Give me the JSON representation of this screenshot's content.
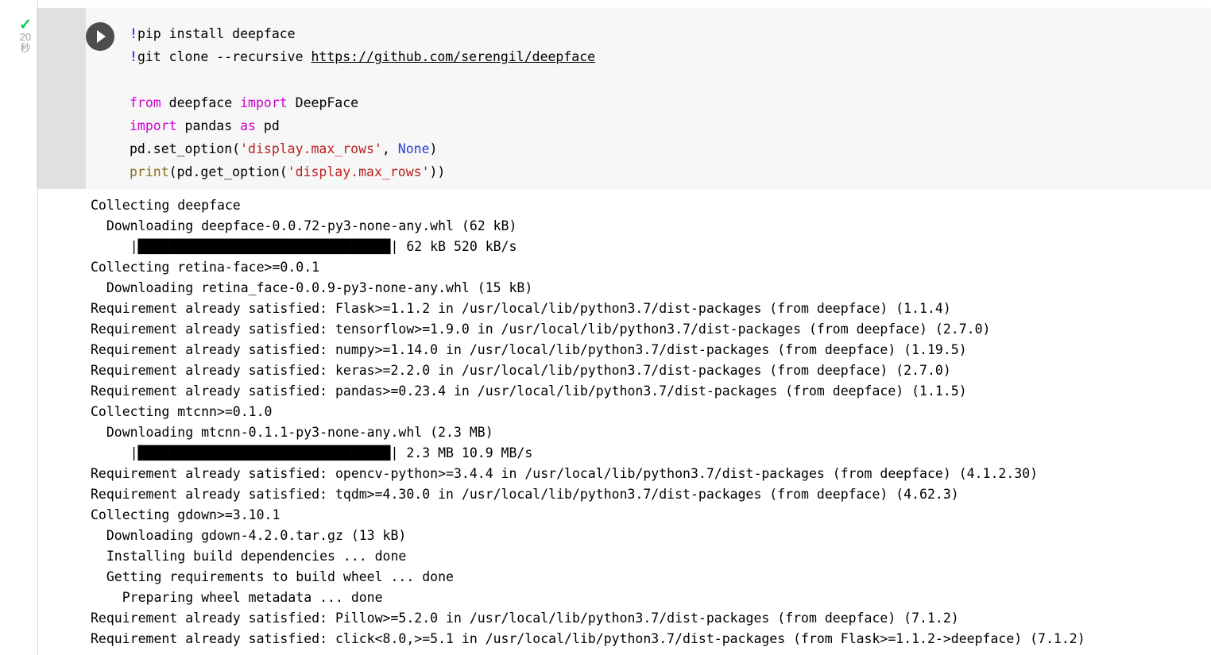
{
  "cell": {
    "execution_status_icon": "check-icon",
    "elapsed_value": "20",
    "elapsed_unit": "秒",
    "run_icon": "play-icon",
    "code_lines": [
      [
        {
          "t": "!",
          "c": "bang"
        },
        {
          "t": "pip install deepface",
          "c": "plain"
        }
      ],
      [
        {
          "t": "!",
          "c": "bang"
        },
        {
          "t": "git clone --recursive ",
          "c": "plain"
        },
        {
          "t": "https://github.com/serengil/deepface",
          "c": "link"
        }
      ],
      [
        {
          "t": "",
          "c": "plain"
        }
      ],
      [
        {
          "t": "from",
          "c": "kw"
        },
        {
          "t": " deepface ",
          "c": "plain"
        },
        {
          "t": "import",
          "c": "kw"
        },
        {
          "t": " DeepFace",
          "c": "plain"
        }
      ],
      [
        {
          "t": "import",
          "c": "kw"
        },
        {
          "t": " pandas ",
          "c": "plain"
        },
        {
          "t": "as",
          "c": "kw"
        },
        {
          "t": " pd",
          "c": "plain"
        }
      ],
      [
        {
          "t": "pd.set_option(",
          "c": "plain"
        },
        {
          "t": "'display.max_rows'",
          "c": "str"
        },
        {
          "t": ", ",
          "c": "plain"
        },
        {
          "t": "None",
          "c": "const"
        },
        {
          "t": ")",
          "c": "plain"
        }
      ],
      [
        {
          "t": "print",
          "c": "builtin"
        },
        {
          "t": "(pd.get_option(",
          "c": "plain"
        },
        {
          "t": "'display.max_rows'",
          "c": "str"
        },
        {
          "t": "))",
          "c": "plain"
        }
      ]
    ]
  },
  "output": {
    "lines": [
      "Collecting deepface",
      "  Downloading deepface-0.0.72-py3-none-any.whl (62 kB)",
      "     |████████████████████████████████| 62 kB 520 kB/s",
      "Collecting retina-face>=0.0.1",
      "  Downloading retina_face-0.0.9-py3-none-any.whl (15 kB)",
      "Requirement already satisfied: Flask>=1.1.2 in /usr/local/lib/python3.7/dist-packages (from deepface) (1.1.4)",
      "Requirement already satisfied: tensorflow>=1.9.0 in /usr/local/lib/python3.7/dist-packages (from deepface) (2.7.0)",
      "Requirement already satisfied: numpy>=1.14.0 in /usr/local/lib/python3.7/dist-packages (from deepface) (1.19.5)",
      "Requirement already satisfied: keras>=2.2.0 in /usr/local/lib/python3.7/dist-packages (from deepface) (2.7.0)",
      "Requirement already satisfied: pandas>=0.23.4 in /usr/local/lib/python3.7/dist-packages (from deepface) (1.1.5)",
      "Collecting mtcnn>=0.1.0",
      "  Downloading mtcnn-0.1.1-py3-none-any.whl (2.3 MB)",
      "     |████████████████████████████████| 2.3 MB 10.9 MB/s",
      "Requirement already satisfied: opencv-python>=3.4.4 in /usr/local/lib/python3.7/dist-packages (from deepface) (4.1.2.30)",
      "Requirement already satisfied: tqdm>=4.30.0 in /usr/local/lib/python3.7/dist-packages (from deepface) (4.62.3)",
      "Collecting gdown>=3.10.1",
      "  Downloading gdown-4.2.0.tar.gz (13 kB)",
      "  Installing build dependencies ... done",
      "  Getting requirements to build wheel ... done",
      "    Preparing wheel metadata ... done",
      "Requirement already satisfied: Pillow>=5.2.0 in /usr/local/lib/python3.7/dist-packages (from deepface) (7.1.2)",
      "Requirement already satisfied: click<8.0,>=5.1 in /usr/local/lib/python3.7/dist-packages (from Flask>=1.1.2->deepface) (7.1.2)"
    ]
  },
  "colors": {
    "cell_background": "#f7f7f7",
    "gutter_background": "#e0e0e0",
    "run_button": "#4d4d4d",
    "success_check": "#00c853",
    "keyword": "#cc00cc",
    "string": "#ba2121",
    "constant": "#2a40d0",
    "builtin": "#8a6d1a",
    "bang": "#0000ff"
  }
}
